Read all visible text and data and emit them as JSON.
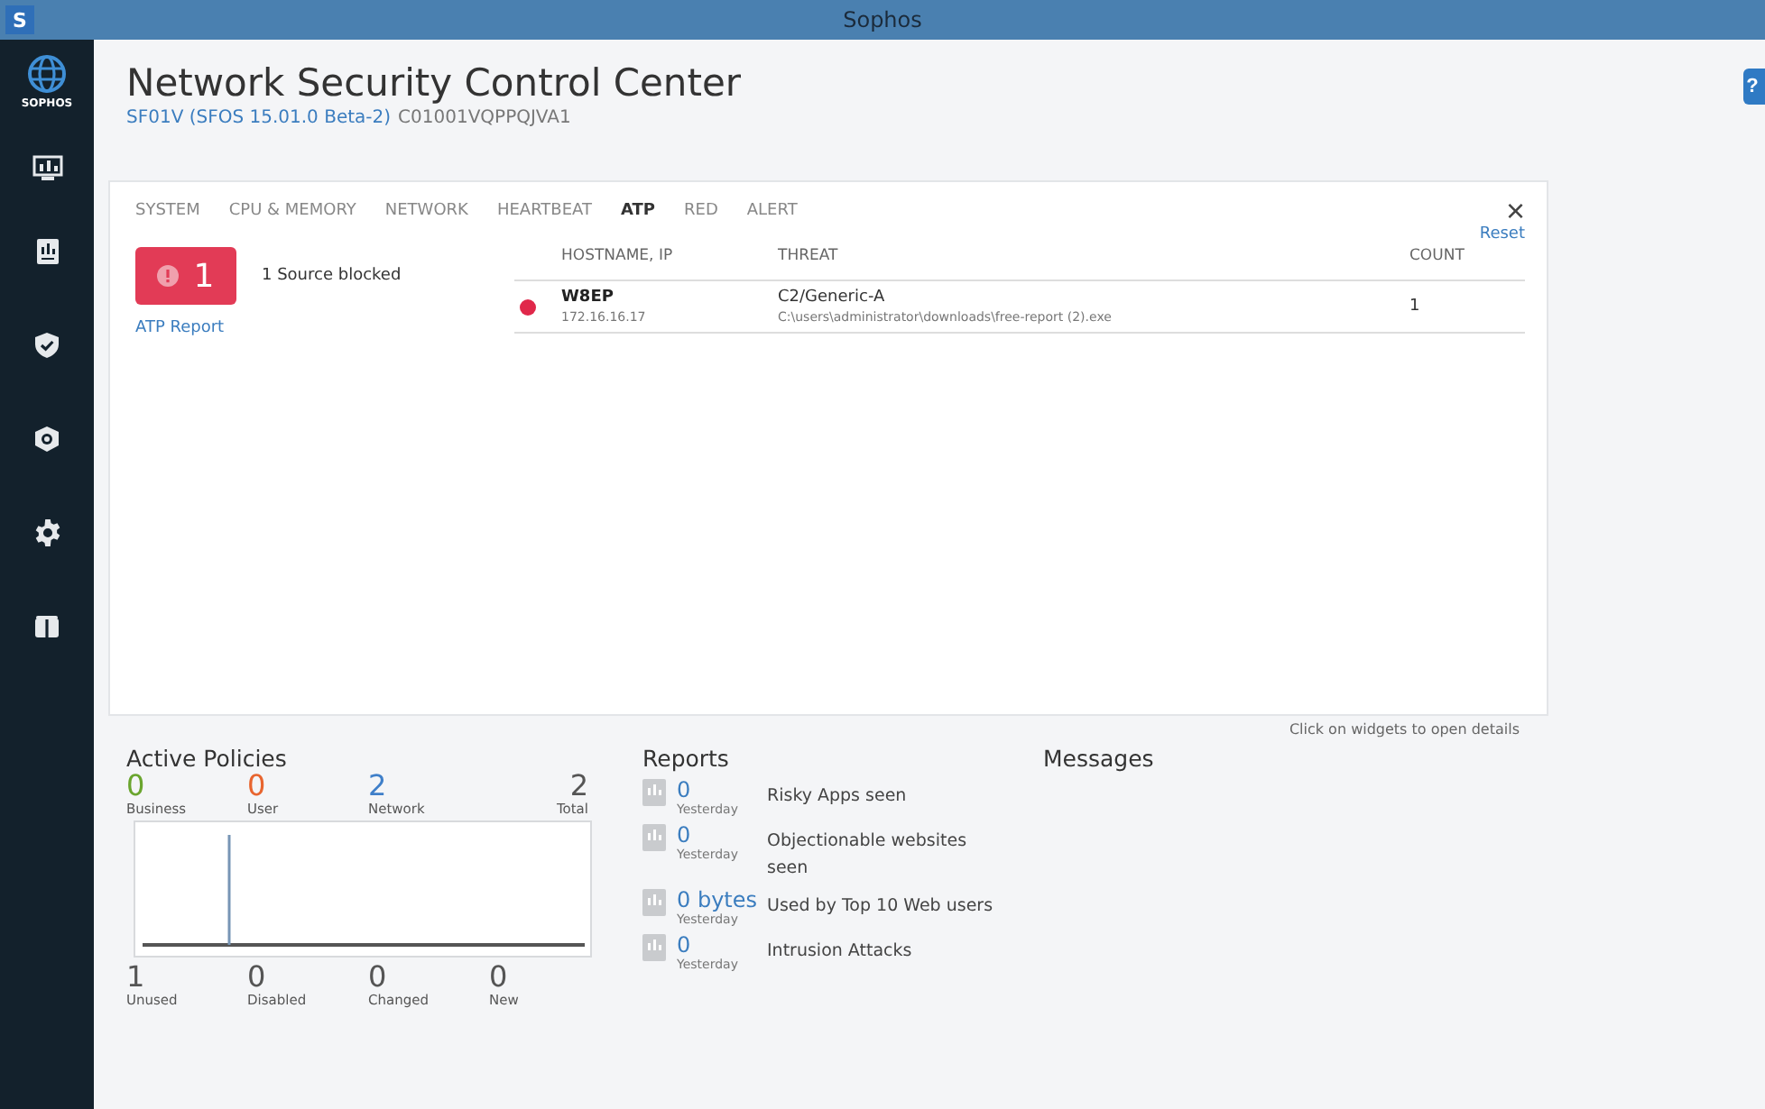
{
  "window": {
    "app_icon": "S",
    "title": "Sophos"
  },
  "help": "?",
  "sidebar": {
    "brand": "SOPHOS",
    "items": [
      {
        "kind": "monitor"
      },
      {
        "kind": "report"
      },
      {
        "kind": "shield"
      },
      {
        "kind": "protect"
      },
      {
        "kind": "gear"
      },
      {
        "kind": "box"
      }
    ]
  },
  "header": {
    "title": "Network Security Control Center",
    "device": "SF01V (SFOS 15.01.0 Beta-2)",
    "serial": "C01001VQPPQJVA1"
  },
  "widget": {
    "tabs": [
      {
        "label": "SYSTEM",
        "selected": false
      },
      {
        "label": "CPU & MEMORY",
        "selected": false
      },
      {
        "label": "NETWORK",
        "selected": false
      },
      {
        "label": "HEARTBEAT",
        "selected": false
      },
      {
        "label": "ATP",
        "selected": true
      },
      {
        "label": "RED",
        "selected": false
      },
      {
        "label": "ALERT",
        "selected": false
      }
    ],
    "close": "×",
    "reset": "Reset",
    "alert_count": "1",
    "summary": "1 Source blocked",
    "report_link": "ATP Report",
    "columns": [
      "HOSTNAME, IP",
      "THREAT",
      "COUNT"
    ],
    "rows": [
      {
        "host": "W8EP",
        "ip": "172.16.16.17",
        "threat": "C2/Generic-A",
        "path": "C:\\users\\administrator\\downloads\\free-report (2).exe",
        "count": "1",
        "color": "#e0284a"
      }
    ]
  },
  "hint": "Click on widgets to open details",
  "policies": {
    "title": "Active Policies",
    "top": [
      {
        "value": "0",
        "label": "Business",
        "color": "#6aa52e"
      },
      {
        "value": "0",
        "label": "User",
        "color": "#e8652f"
      },
      {
        "value": "2",
        "label": "Network",
        "color": "#3f7fc9"
      },
      {
        "value": "2",
        "label": "Total",
        "color": "#555555"
      }
    ],
    "bottom": [
      {
        "value": "1",
        "label": "Unused"
      },
      {
        "value": "0",
        "label": "Disabled"
      },
      {
        "value": "0",
        "label": "Changed"
      },
      {
        "value": "0",
        "label": "New"
      }
    ]
  },
  "reports": {
    "title": "Reports",
    "items": [
      {
        "value": "0",
        "period": "Yesterday",
        "label": "Risky Apps seen"
      },
      {
        "value": "0",
        "period": "Yesterday",
        "label": "Objectionable websites seen"
      },
      {
        "value": "0 bytes",
        "period": "Yesterday",
        "label": "Used by Top 10 Web users"
      },
      {
        "value": "0",
        "period": "Yesterday",
        "label": "Intrusion Attacks"
      }
    ]
  },
  "messages": {
    "title": "Messages"
  }
}
